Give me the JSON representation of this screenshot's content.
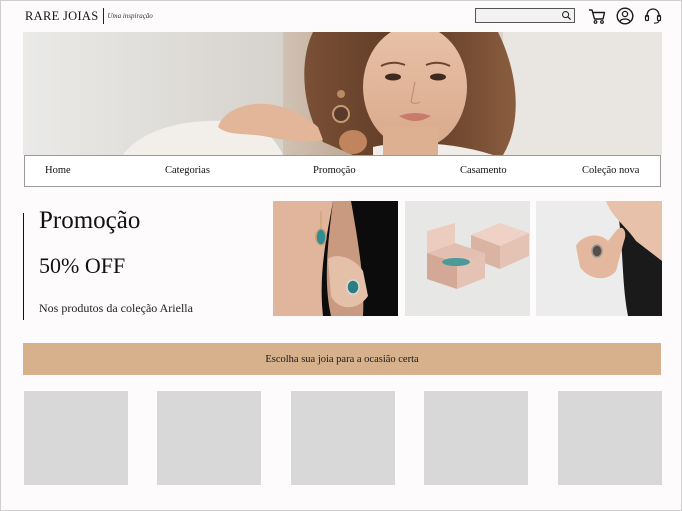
{
  "brand": {
    "name": "RARE JOIAS",
    "tagline": "Uma inspiração"
  },
  "header": {
    "search": {
      "value": "",
      "placeholder": ""
    },
    "icons": [
      "search-icon",
      "cart-icon",
      "user-icon",
      "support-icon"
    ]
  },
  "nav": {
    "items": [
      {
        "label": "Home"
      },
      {
        "label": "Categorias"
      },
      {
        "label": "Promoção"
      },
      {
        "label": "Casamento"
      },
      {
        "label": "Coleção nova"
      }
    ]
  },
  "promo": {
    "title": "Promoção",
    "discount": "50% OFF",
    "description": "Nos produtos da coleção Ariella"
  },
  "occasion": {
    "label": "Escolha sua joia para a ocasião certa"
  },
  "products": {
    "placeholder_count": 5
  },
  "colors": {
    "accent": "#d6b18c",
    "placeholder": "#d8d8d8",
    "box_pink": "#e5c3b4"
  }
}
